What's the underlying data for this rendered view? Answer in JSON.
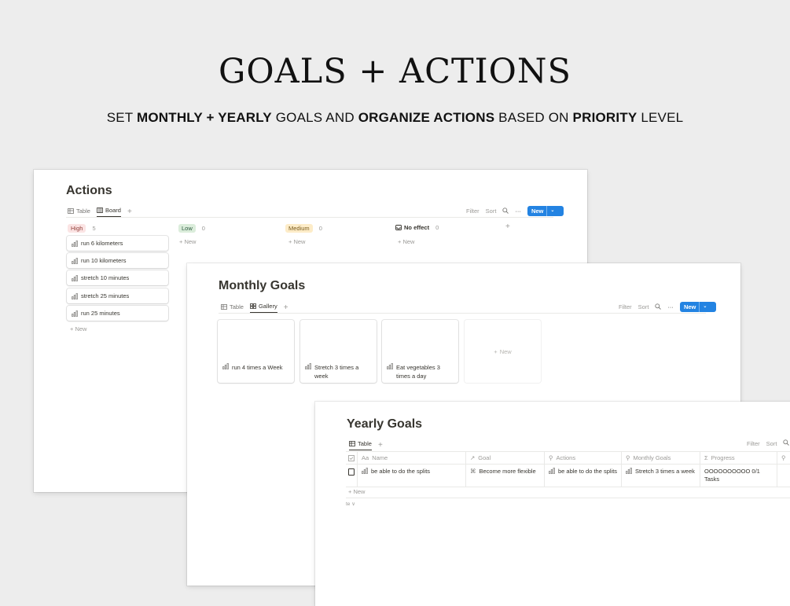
{
  "hero": {
    "title": "GOALS + ACTIONS",
    "sub_1": "SET ",
    "sub_2": "MONTHLY + YEARLY",
    "sub_3": " GOALS AND ",
    "sub_4": "ORGANIZE ACTIONS",
    "sub_5": " BASED ON ",
    "sub_6": "PRIORITY",
    "sub_7": " LEVEL"
  },
  "actions": {
    "title": "Actions",
    "views": [
      "Table",
      "Board"
    ],
    "active_view": "Board",
    "toolbar": {
      "filter": "Filter",
      "sort": "Sort",
      "more": "···",
      "new": "New"
    },
    "columns": [
      {
        "label": "High",
        "count": "5",
        "bg": "#fbe4e4",
        "fg": "#93413b"
      },
      {
        "label": "Low",
        "count": "0",
        "bg": "#dbeddb",
        "fg": "#2b593f"
      },
      {
        "label": "Medium",
        "count": "0",
        "bg": "#fdecc8",
        "fg": "#7a5b1c"
      },
      {
        "label": "No effect",
        "count": "0",
        "bg": "transparent",
        "fg": "#37352f"
      }
    ],
    "cards": [
      "run 6 kilometers",
      "run 10 kilometers",
      "stretch 10 minutes",
      "stretch 25 minutes",
      "run 25 minutes"
    ],
    "add_new": "New"
  },
  "monthly": {
    "title": "Monthly Goals",
    "views": [
      "Table",
      "Gallery"
    ],
    "active_view": "Gallery",
    "toolbar": {
      "filter": "Filter",
      "sort": "Sort",
      "more": "···",
      "new": "New"
    },
    "cards": [
      "run 4 times a Week",
      "Stretch 3 times a week",
      "Eat vegetables 3 times a day"
    ],
    "add_new": "New"
  },
  "yearly": {
    "title": "Yearly Goals",
    "views": [
      "Table"
    ],
    "active_view": "Table",
    "toolbar": {
      "filter": "Filter",
      "sort": "Sort"
    },
    "columns": [
      "Name",
      "Goal",
      "Actions",
      "Monthly Goals",
      "Progress"
    ],
    "rows": [
      {
        "name": "be able to do the splits",
        "goal": "Become more flexible",
        "actions": "be able to do the splits",
        "monthly_goals": "Stretch 3 times a week",
        "progress": "OOOOOOOOOO 0/1 Tasks"
      }
    ],
    "add_new": "New",
    "calc": "te ∨"
  },
  "colors": {
    "accent": "#2383e2",
    "text": "#37352f",
    "muted": "#9b9a97",
    "page_bg": "#ededed"
  }
}
